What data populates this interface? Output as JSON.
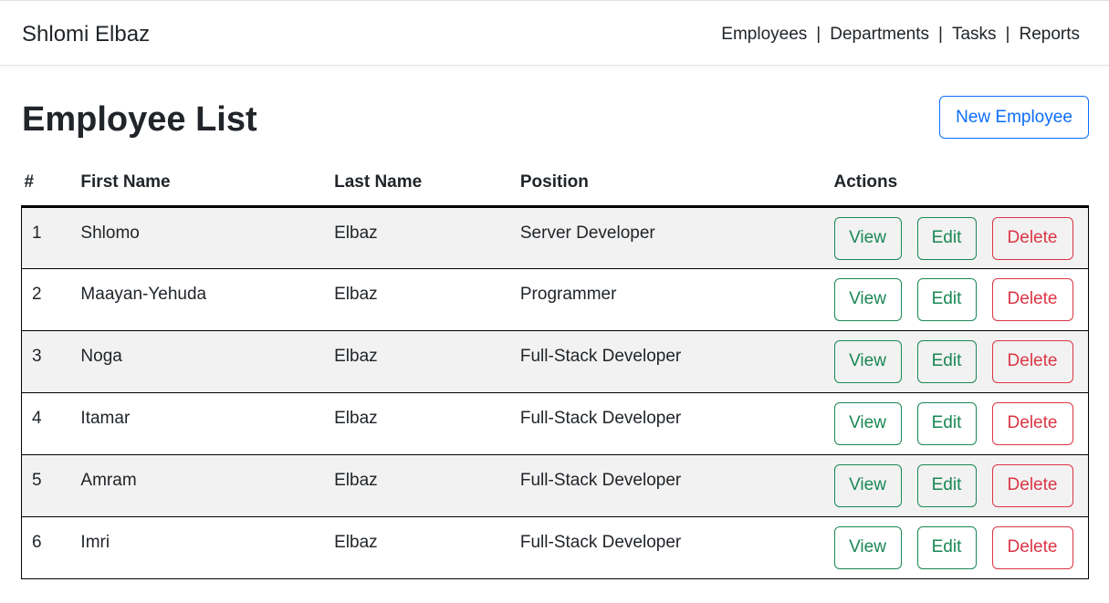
{
  "navbar": {
    "brand": "Shlomi Elbaz",
    "links": [
      "Employees",
      "Departments",
      "Tasks",
      "Reports"
    ],
    "separator": "|"
  },
  "page": {
    "title": "Employee List",
    "new_button": "New Employee"
  },
  "table": {
    "headers": [
      "#",
      "First Name",
      "Last Name",
      "Position",
      "Actions"
    ],
    "rows": [
      {
        "num": "1",
        "first": "Shlomo",
        "last": "Elbaz",
        "position": "Server Developer"
      },
      {
        "num": "2",
        "first": "Maayan-Yehuda",
        "last": "Elbaz",
        "position": "Programmer"
      },
      {
        "num": "3",
        "first": "Noga",
        "last": "Elbaz",
        "position": "Full-Stack Developer"
      },
      {
        "num": "4",
        "first": "Itamar",
        "last": "Elbaz",
        "position": "Full-Stack Developer"
      },
      {
        "num": "5",
        "first": "Amram",
        "last": "Elbaz",
        "position": "Full-Stack Developer"
      },
      {
        "num": "6",
        "first": "Imri",
        "last": "Elbaz",
        "position": "Full-Stack Developer"
      }
    ],
    "actions": {
      "view": "View",
      "edit": "Edit",
      "delete": "Delete"
    }
  },
  "colors": {
    "primary": "#0d6efd",
    "success": "#198754",
    "danger": "#dc3545",
    "stripe": "#f2f2f2"
  }
}
